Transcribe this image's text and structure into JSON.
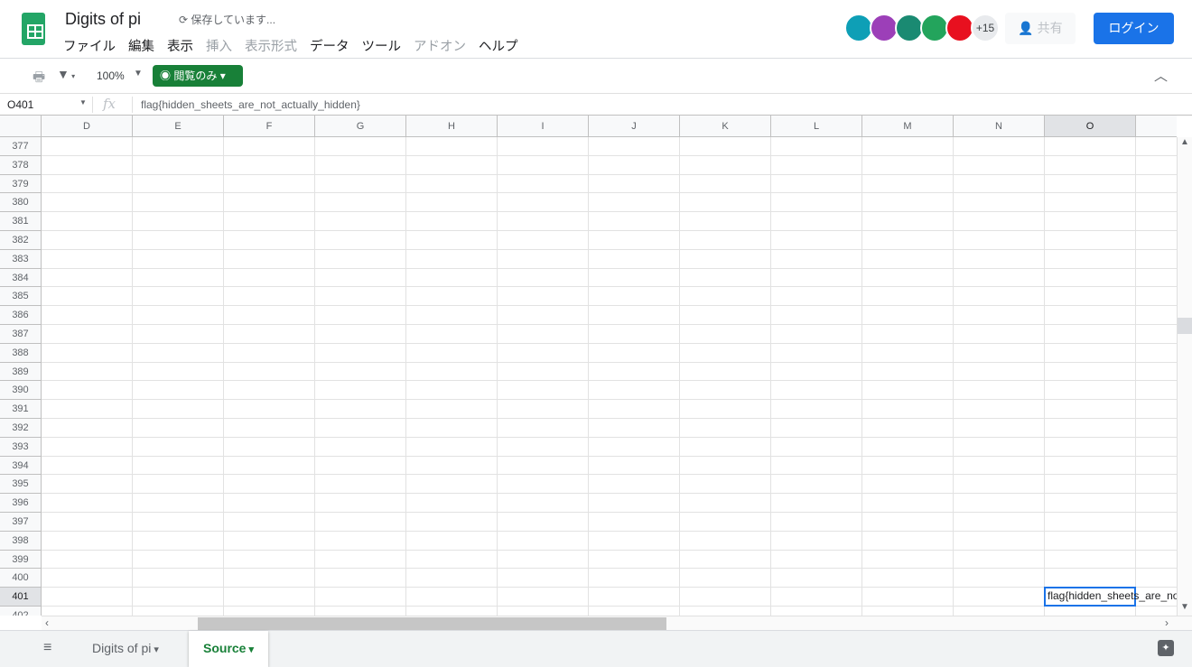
{
  "app": {
    "title": "Digits of pi",
    "save_status": "保存しています...",
    "menu": [
      {
        "label": "ファイル",
        "enabled": true
      },
      {
        "label": "編集",
        "enabled": true
      },
      {
        "label": "表示",
        "enabled": true
      },
      {
        "label": "挿入",
        "enabled": false
      },
      {
        "label": "表示形式",
        "enabled": false
      },
      {
        "label": "データ",
        "enabled": true
      },
      {
        "label": "ツール",
        "enabled": true
      },
      {
        "label": "アドオン",
        "enabled": false
      },
      {
        "label": "ヘルプ",
        "enabled": true
      }
    ]
  },
  "collaborators": {
    "avatars": [
      "#0e9fb6",
      "#9c3fb8",
      "#1a8a72",
      "#23a45c",
      "#e8101f"
    ],
    "more": "+15"
  },
  "header": {
    "share": "共有",
    "login": "ログイン"
  },
  "toolbar": {
    "zoom": "100%",
    "view_only": "閲覧のみ"
  },
  "formula_bar": {
    "cell_ref": "O401",
    "fx": "fx",
    "value": "flag{hidden_sheets_are_not_actually_hidden}"
  },
  "grid": {
    "columns": [
      "D",
      "E",
      "F",
      "G",
      "H",
      "I",
      "J",
      "K",
      "L",
      "M",
      "N",
      "O"
    ],
    "selected_column": "O",
    "rows": [
      "377",
      "378",
      "379",
      "380",
      "381",
      "382",
      "383",
      "384",
      "385",
      "386",
      "387",
      "388",
      "389",
      "390",
      "391",
      "392",
      "393",
      "394",
      "395",
      "396",
      "397",
      "398",
      "399",
      "400",
      "401",
      "402"
    ],
    "selected_row": "401",
    "selected_cell_text": "flag{hidden_sheets_are_not_actually_hidden}"
  },
  "sheets": {
    "tabs": [
      {
        "label": "Digits of pi",
        "active": false
      },
      {
        "label": "Source",
        "active": true
      }
    ]
  }
}
